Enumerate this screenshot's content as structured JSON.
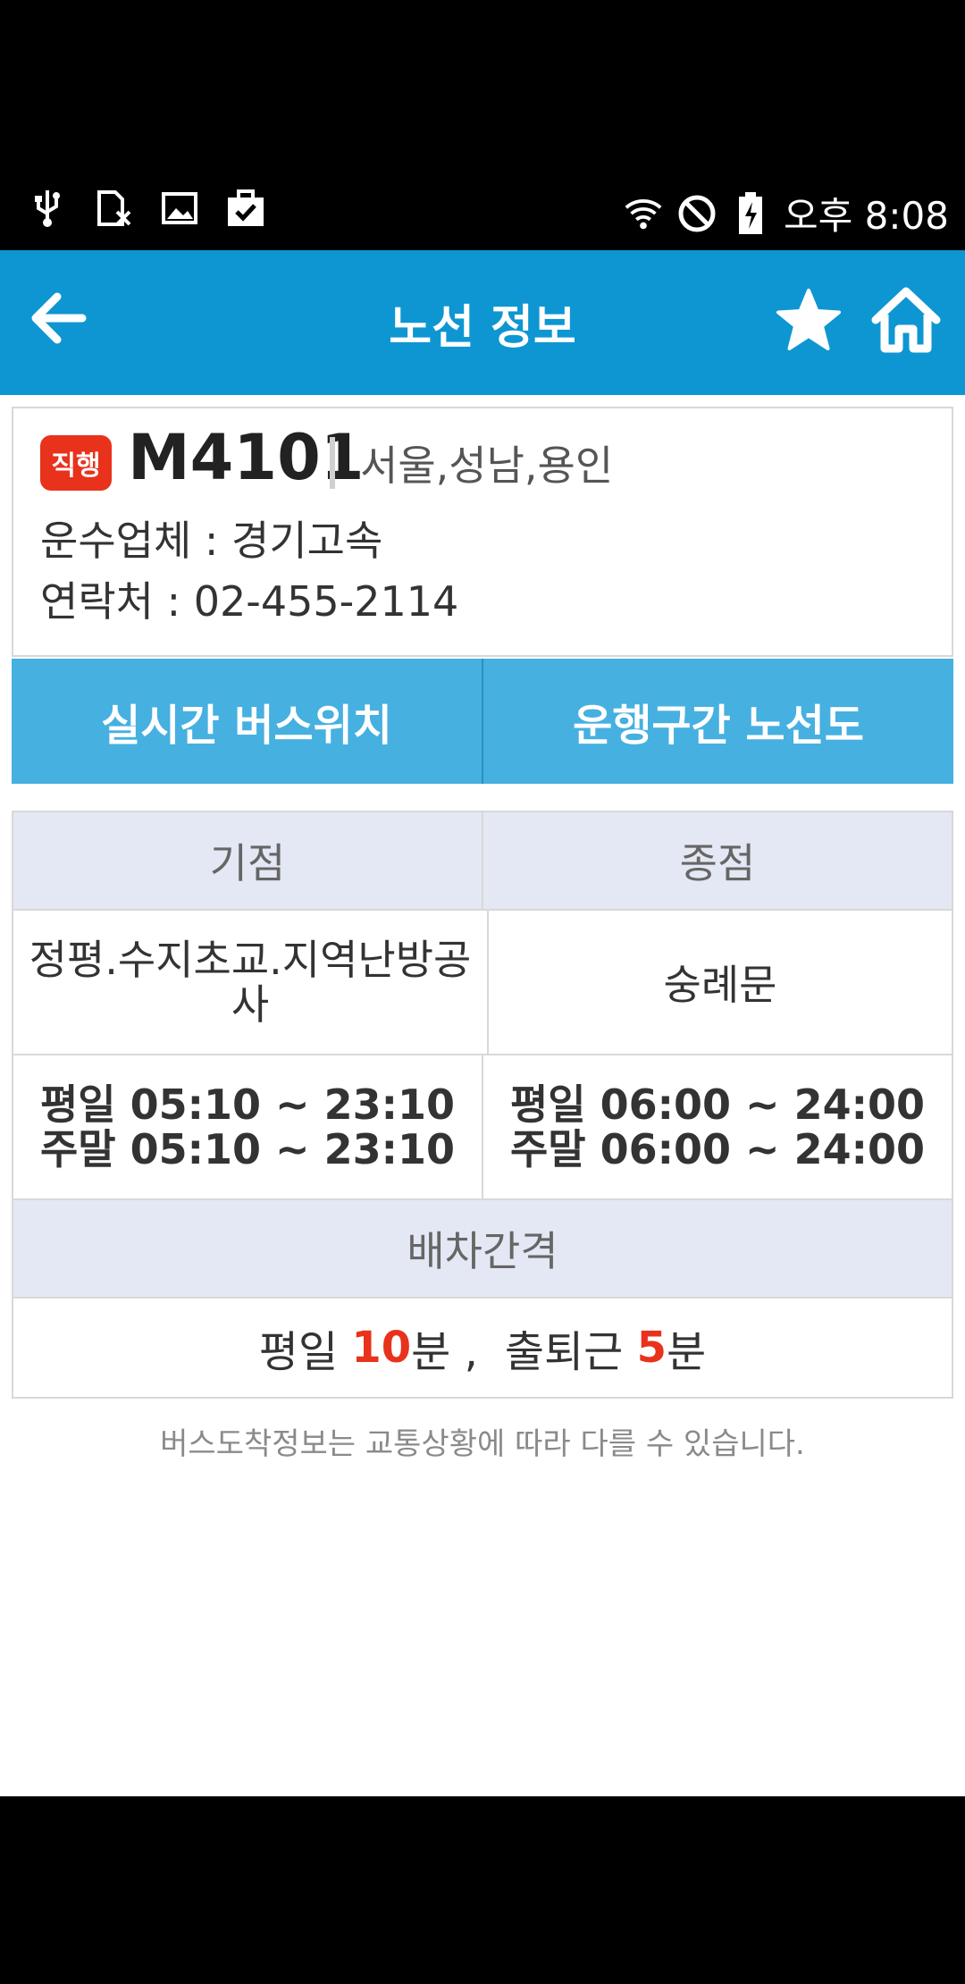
{
  "status": {
    "time": "오후 8:08",
    "left_icons": [
      "usb-icon",
      "sim-icon",
      "image-icon",
      "briefcase-check-icon"
    ],
    "right_icons": [
      "wifi-icon",
      "do-not-disturb-icon",
      "battery-charging-icon"
    ]
  },
  "header": {
    "title": "노선 정보"
  },
  "route": {
    "badge": "직행",
    "number": "M4101",
    "region": "서울,성남,용인",
    "company": "운수업체 : 경기고속",
    "contact": "연락처 : 02-455-2114"
  },
  "buttons": {
    "realtime": "실시간 버스위치",
    "route_map": "운행구간 노선도"
  },
  "table": {
    "start_header": "기점",
    "end_header": "종점",
    "start_stop": "정평.수지초교.지역난방공사",
    "end_stop": "숭례문",
    "start_weekday": "평일 05:10 ~ 23:10",
    "start_weekend": "주말 05:10 ~ 23:10",
    "end_weekday": "평일 06:00 ~ 24:00",
    "end_weekend": "주말 06:00 ~ 24:00",
    "interval_header": "배차간격",
    "interval": {
      "weekday_label": "평일 ",
      "weekday_value": "10",
      "weekday_unit": "분 ,",
      "rush_label": "출퇴근 ",
      "rush_value": "5",
      "rush_unit": "분"
    }
  },
  "note": "버스도착정보는 교통상황에 따라 다를 수 있습니다.",
  "colors": {
    "primary": "#0e96d2",
    "button": "#46b0e0",
    "badge": "#e8321c",
    "header_cell": "#e4e8f4"
  }
}
